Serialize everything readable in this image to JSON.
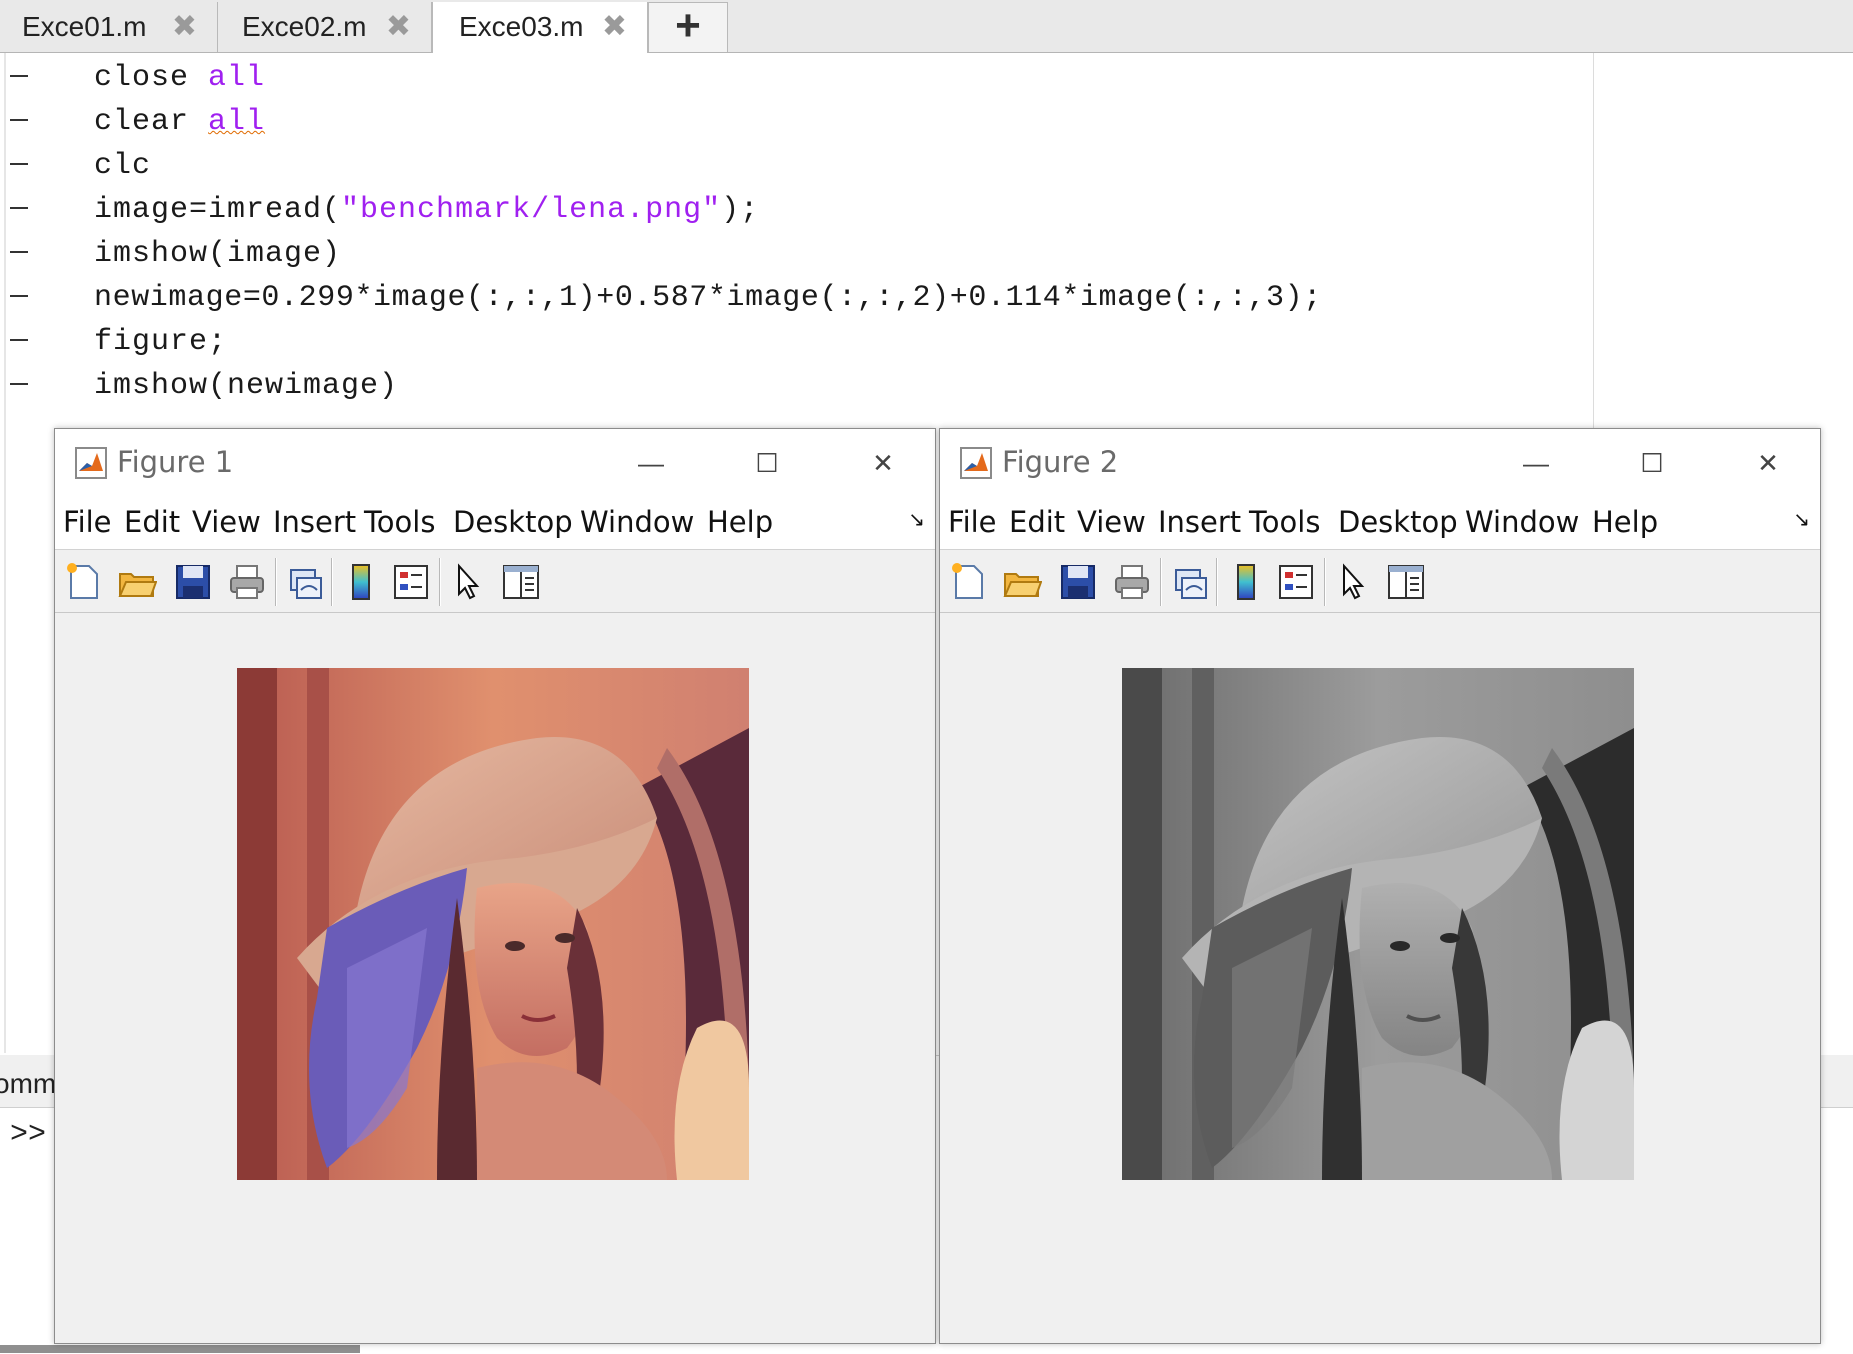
{
  "editor": {
    "tabs": [
      {
        "label": "Exce01.m",
        "close": "✖",
        "active": false
      },
      {
        "label": "Exce02.m",
        "close": "✖",
        "active": false
      },
      {
        "label": "Exce03.m",
        "close": "✖",
        "active": true
      }
    ],
    "add_tab": "+",
    "code": [
      {
        "plain": "close ",
        "kw": "all"
      },
      {
        "plain": "clear ",
        "kw": "all"
      },
      {
        "plain": "clc"
      },
      {
        "pre": "image=imread(",
        "str": "\"benchmark/lena.png\"",
        "post": ");"
      },
      {
        "plain": "imshow(image)"
      },
      {
        "plain": "newimage=0.299*image(:,:,1)+0.587*image(:,:,2)+0.114*image(:,:,3);"
      },
      {
        "plain": "figure;"
      },
      {
        "plain": "imshow(newimage)"
      }
    ]
  },
  "command_window": {
    "header_label": "omm",
    "prompt": ">>"
  },
  "figures": [
    {
      "title": "Figure 1",
      "image_kind": "color",
      "menu": [
        "File",
        "Edit",
        "View",
        "Insert",
        "Tools",
        "Desktop",
        "Window",
        "Help"
      ],
      "menu_arrow": "↘"
    },
    {
      "title": "Figure 2",
      "image_kind": "grayscale",
      "menu": [
        "File",
        "Edit",
        "View",
        "Insert",
        "Tools",
        "Desktop",
        "Window",
        "Help"
      ],
      "menu_arrow": "↘"
    }
  ],
  "window_buttons": {
    "minimize": "—",
    "maximize": "☐",
    "close": "✕"
  },
  "colors": {
    "keyword": "#a020f0",
    "string": "#a020f0",
    "window_bg": "#f0f0f0"
  },
  "toolbar_icons": [
    "new-figure-icon",
    "open-file-icon",
    "save-icon",
    "print-icon",
    "link-plot-icon",
    "colorbar-icon",
    "legend-icon",
    "pointer-icon",
    "property-editor-icon"
  ]
}
